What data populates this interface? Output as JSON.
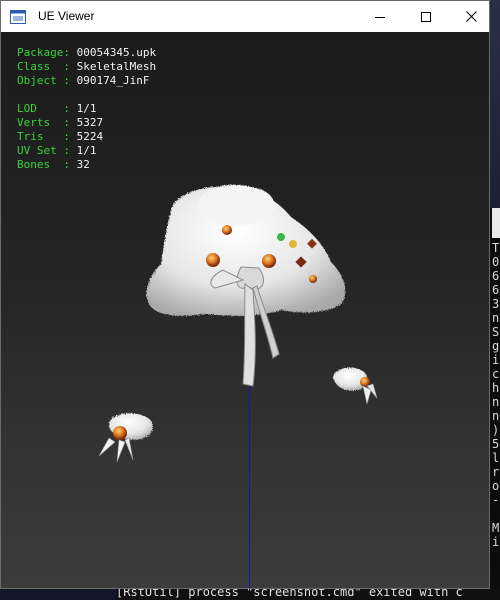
{
  "window": {
    "title": "UE Viewer",
    "controls": {
      "minimize": "minimize",
      "maximize": "maximize",
      "close": "close"
    }
  },
  "info": {
    "package": {
      "label": "Package:",
      "value": "00054345.upk"
    },
    "class": {
      "label": "Class  :",
      "value": "SkeletalMesh"
    },
    "object": {
      "label": "Object :",
      "value": "090174_JinF"
    },
    "lod": {
      "label": "LOD    :",
      "value": "1/1"
    },
    "verts": {
      "label": "Verts  :",
      "value": "5327"
    },
    "tris": {
      "label": "Tris   :",
      "value": "5224"
    },
    "uvset": {
      "label": "UV Set :",
      "value": "1/1"
    },
    "bones": {
      "label": "Bones  :",
      "value": "32"
    }
  },
  "background": {
    "left_char": "M",
    "side_chars": [
      "T",
      "0",
      "6",
      "6",
      "3",
      "n",
      "S",
      "g",
      "i",
      "c",
      "h",
      "n",
      "n",
      ")",
      "5",
      "l",
      "r",
      "o",
      "-",
      "",
      "M",
      "i"
    ],
    "console_text": "[RstUtil] process \"screenshot.cmd\" exited with c"
  },
  "colors": {
    "label_green": "#39d239",
    "value_white": "#f2f2f2",
    "axis_blue": "#1414b8"
  }
}
